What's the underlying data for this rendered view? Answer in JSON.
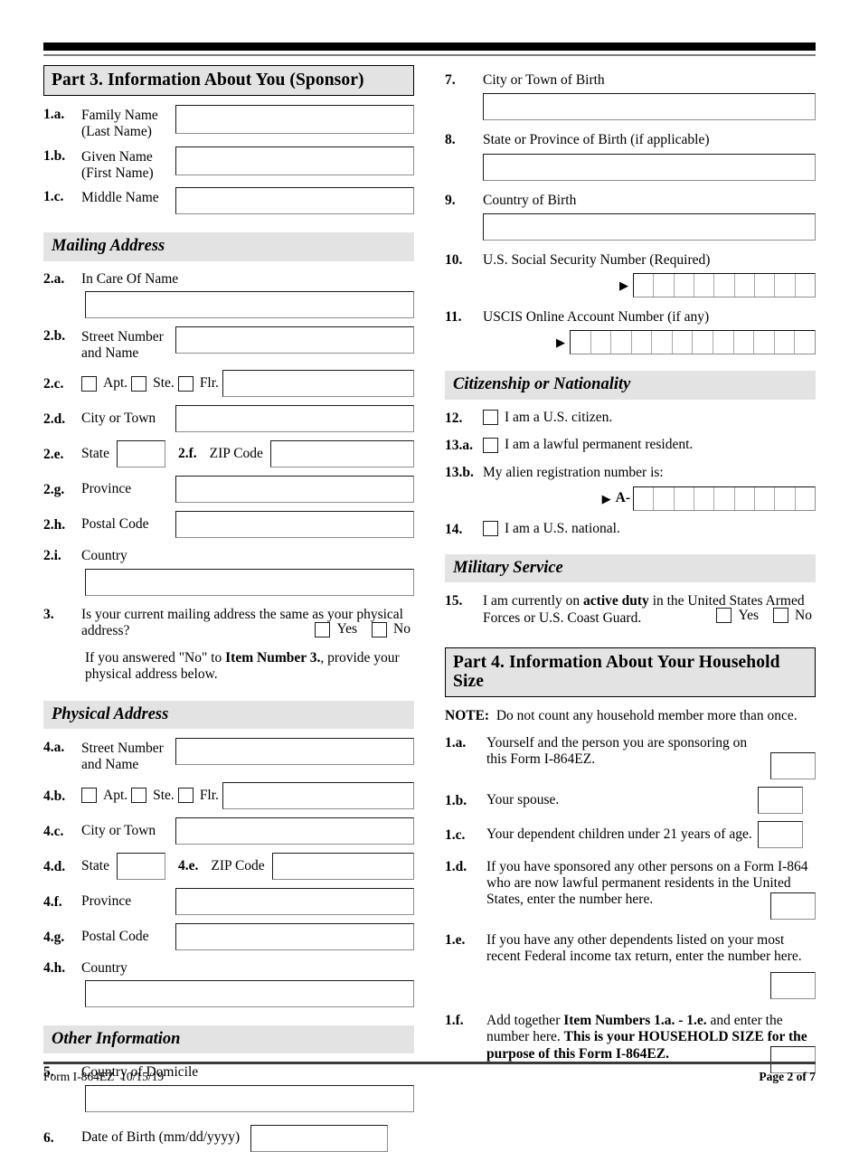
{
  "document": {
    "form_number": "Form I-864EZ",
    "form_date": "10/15/19",
    "page_label": "Page 2 of 7"
  },
  "part3": {
    "header": "Part 3.  Information About You (Sponsor)",
    "names": [
      {
        "num": "1.a.",
        "label": "Family Name",
        "label2": "(Last Name)"
      },
      {
        "num": "1.b.",
        "label": "Given Name",
        "label2": "(First Name)"
      },
      {
        "num": "1.c.",
        "label": "Middle Name",
        "label2": ""
      }
    ],
    "mailing_address": {
      "header": "Mailing Address",
      "in_care_of": {
        "num": "2.a.",
        "label": "In Care Of Name"
      },
      "street": {
        "num": "2.b.",
        "label": "Street Number",
        "label2": "and Name"
      },
      "unit": {
        "num": "2.c.",
        "options": [
          "Apt.",
          "Ste.",
          "Flr."
        ]
      },
      "city": {
        "num": "2.d.",
        "label": "City or Town"
      },
      "state": {
        "num": "2.e.",
        "label": "State"
      },
      "zip": {
        "num": "2.f.",
        "label": "ZIP Code"
      },
      "province": {
        "num": "2.g.",
        "label": "Province"
      },
      "postal": {
        "num": "2.h.",
        "label": "Postal Code"
      },
      "country": {
        "num": "2.i.",
        "label": "Country"
      }
    },
    "item3": {
      "num": "3.",
      "question": "Is your current mailing address the same as your physical address?",
      "yes": "Yes",
      "no": "No",
      "instruction_pre": "If you answered \"No\" to ",
      "instruction_bold": "Item Number 3.",
      "instruction_post": ", provide your physical address below."
    },
    "physical_address": {
      "header": "Physical Address",
      "street": {
        "num": "4.a.",
        "label": "Street Number",
        "label2": "and Name"
      },
      "unit": {
        "num": "4.b.",
        "options": [
          "Apt.",
          "Ste.",
          "Flr."
        ]
      },
      "city": {
        "num": "4.c.",
        "label": "City or Town"
      },
      "state": {
        "num": "4.d.",
        "label": "State"
      },
      "zip": {
        "num": "4.e.",
        "label": "ZIP Code"
      },
      "province": {
        "num": "4.f.",
        "label": "Province"
      },
      "postal": {
        "num": "4.g.",
        "label": "Postal Code"
      },
      "country": {
        "num": "4.h.",
        "label": "Country"
      }
    },
    "other_information": {
      "header": "Other Information",
      "domicile": {
        "num": "5.",
        "label": "Country of Domicile"
      },
      "dob": {
        "num": "6.",
        "label": "Date of Birth (mm/dd/yyyy)"
      }
    },
    "birth": {
      "city": {
        "num": "7.",
        "label": "City or Town of Birth"
      },
      "state": {
        "num": "8.",
        "label": "State or Province of Birth (if applicable)"
      },
      "country": {
        "num": "9.",
        "label": "Country of Birth"
      }
    },
    "ssn": {
      "num": "10.",
      "label": "U.S. Social Security Number (Required)",
      "cells": 9
    },
    "uscis": {
      "num": "11.",
      "label": "USCIS Online Account Number (if any)",
      "cells": 12
    },
    "citizenship": {
      "header": "Citizenship or Nationality",
      "item12": {
        "num": "12.",
        "label": "I am a U.S. citizen."
      },
      "item13a": {
        "num": "13.a.",
        "label": "I am a lawful permanent resident."
      },
      "item13b": {
        "num": "13.b.",
        "label": "My alien registration number is:",
        "prefix": "A-",
        "cells": 9
      },
      "item14": {
        "num": "14.",
        "label": "I am a U.S. national."
      }
    },
    "military": {
      "header": "Military Service",
      "item15": {
        "num": "15.",
        "text_pre": "I am currently on ",
        "text_bold": "active duty",
        "text_post": " in the United States Armed Forces or U.S. Coast Guard.",
        "yes": "Yes",
        "no": "No"
      }
    }
  },
  "part4": {
    "header": "Part 4.  Information About Your Household Size",
    "note_label": "NOTE:",
    "note_text": "Do not count any household member more than once.",
    "items": [
      {
        "num": "1.a.",
        "text": "Yourself and the person you are sponsoring on this Form I-864EZ."
      },
      {
        "num": "1.b.",
        "text": "Your spouse."
      },
      {
        "num": "1.c.",
        "text": "Your dependent children under 21 years of age."
      },
      {
        "num": "1.d.",
        "text": "If you have sponsored any other persons on a Form I-864 who are now lawful permanent residents in the United States, enter the number here."
      },
      {
        "num": "1.e.",
        "text": "If you have any other dependents listed on your most recent Federal income tax return, enter the number here."
      }
    ],
    "item1f": {
      "num": "1.f.",
      "text_pre": "Add together ",
      "text_bold1": "Item Numbers 1.a. - 1.e.",
      "text_mid": " and enter the number here.  ",
      "text_bold2": "This is your HOUSEHOLD SIZE for the purpose of this Form I-864EZ."
    }
  }
}
